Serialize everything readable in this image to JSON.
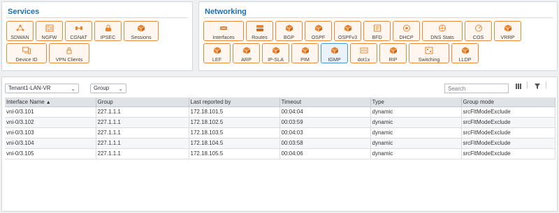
{
  "services": {
    "title": "Services",
    "tiles": [
      {
        "label": "SDWAN",
        "icon": "sdwan-icon"
      },
      {
        "label": "NGFW",
        "icon": "firewall-icon"
      },
      {
        "label": "CGNAT",
        "icon": "cgnat-icon"
      },
      {
        "label": "IPSEC",
        "icon": "ipsec-icon"
      },
      {
        "label": "Sessions",
        "icon": "sessions-icon"
      },
      {
        "label": "Device ID",
        "icon": "device-id-icon"
      },
      {
        "label": "VPN Clients",
        "icon": "vpn-lock-icon"
      }
    ]
  },
  "networking": {
    "title": "Networking",
    "tiles": [
      {
        "label": "Interfaces",
        "icon": "interfaces-icon"
      },
      {
        "label": "Routes",
        "icon": "routes-icon"
      },
      {
        "label": "BGP",
        "icon": "cube-icon"
      },
      {
        "label": "OSPF",
        "icon": "cube-icon"
      },
      {
        "label": "OSPFv3",
        "icon": "cube-icon"
      },
      {
        "label": "BFD",
        "icon": "bfd-icon"
      },
      {
        "label": "DHCP",
        "icon": "dhcp-icon"
      },
      {
        "label": "DNS Stats",
        "icon": "dns-icon"
      },
      {
        "label": "COS",
        "icon": "cos-icon"
      },
      {
        "label": "VRRP",
        "icon": "cube-icon"
      },
      {
        "label": "LEF",
        "icon": "cube-icon"
      },
      {
        "label": "ARP",
        "icon": "cube-icon"
      },
      {
        "label": "IP-SLA",
        "icon": "cube-icon"
      },
      {
        "label": "PIM",
        "icon": "cube-icon"
      },
      {
        "label": "IGMP",
        "icon": "cube-icon"
      },
      {
        "label": "dot1x",
        "icon": "dot1x-icon"
      },
      {
        "label": "RIP",
        "icon": "cube-icon"
      },
      {
        "label": "Switching",
        "icon": "switching-icon"
      },
      {
        "label": "LLDP",
        "icon": "cube-icon"
      }
    ],
    "active": "IGMP"
  },
  "filters": {
    "vr_select": "Tenant1-LAN-VR",
    "group_select": "Group",
    "search_placeholder": "Search"
  },
  "table": {
    "columns": [
      "Interface Name",
      "Group",
      "Last reported by",
      "Timeout",
      "Type",
      "Group mode"
    ],
    "rows": [
      [
        "vni-0/3.101",
        "227.1.1.1",
        "172.18.101.5",
        "00:04:04",
        "dynamic",
        "srcFltModeExclude"
      ],
      [
        "vni-0/3.102",
        "227.1.1.1",
        "172.18.102.5",
        "00:03:59",
        "dynamic",
        "srcFltModeExclude"
      ],
      [
        "vni-0/3.103",
        "227.1.1.1",
        "172.18.103.5",
        "00:04:03",
        "dynamic",
        "srcFltModeExclude"
      ],
      [
        "vni-0/3.104",
        "227.1.1.1",
        "172.18.104.5",
        "00:03:58",
        "dynamic",
        "srcFltModeExclude"
      ],
      [
        "vni-0/3.105",
        "227.1.1.1",
        "172.18.105.5",
        "00:04:06",
        "dynamic",
        "srcFltModeExclude"
      ]
    ]
  },
  "colors": {
    "accent": "#1a6fb5",
    "tile_border": "#e98a3b",
    "icon": "#e8832e"
  }
}
